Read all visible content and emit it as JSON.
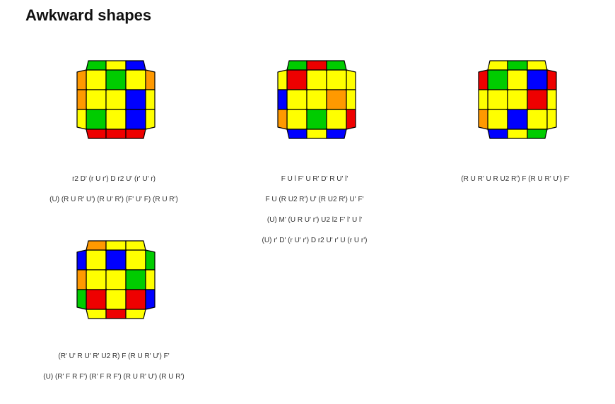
{
  "page": {
    "title": "Awkward shapes"
  },
  "colors": {
    "Y": "#ffff00",
    "R": "#ee0000",
    "G": "#00cc00",
    "B": "#0000ff",
    "O": "#ff9900",
    "border": "#000000"
  },
  "cases": [
    {
      "top": [
        "G",
        "Y",
        "B"
      ],
      "left": [
        "O",
        "O",
        "Y"
      ],
      "grid": [
        [
          "Y",
          "G",
          "Y"
        ],
        [
          "Y",
          "Y",
          "B"
        ],
        [
          "G",
          "Y",
          "B"
        ]
      ],
      "right": [
        "O",
        "Y",
        "Y"
      ],
      "bottom": [
        "R",
        "R",
        "R"
      ],
      "algs": [
        "r2 D' (r U r') D r2 U' (r' U' r)",
        "(U) (R U R' U') (R U' R') (F' U' F) (R U R')"
      ]
    },
    {
      "top": [
        "G",
        "R",
        "G"
      ],
      "left": [
        "Y",
        "B",
        "O"
      ],
      "grid": [
        [
          "R",
          "Y",
          "Y"
        ],
        [
          "Y",
          "Y",
          "O"
        ],
        [
          "Y",
          "G",
          "Y"
        ]
      ],
      "right": [
        "Y",
        "Y",
        "R"
      ],
      "bottom": [
        "B",
        "Y",
        "B"
      ],
      "algs": [
        "F U l F' U R' D' R U' l'",
        "F U (R U2 R') U' (R U2 R') U' F'",
        "(U) M' (U R U' r') U2 l2 F' l' U l'",
        "(U) r' D' (r U' r') D r2 U' r' U (r U r')"
      ]
    },
    {
      "top": [
        "Y",
        "G",
        "Y"
      ],
      "left": [
        "R",
        "Y",
        "O"
      ],
      "grid": [
        [
          "G",
          "Y",
          "B"
        ],
        [
          "Y",
          "Y",
          "R"
        ],
        [
          "Y",
          "B",
          "Y"
        ]
      ],
      "right": [
        "R",
        "Y",
        "Y"
      ],
      "bottom": [
        "B",
        "Y",
        "G"
      ],
      "algs": [
        "(R U R' U R U2 R') F (R U R' U') F'"
      ]
    },
    {
      "top": [
        "O",
        "Y",
        "Y"
      ],
      "left": [
        "B",
        "O",
        "G"
      ],
      "grid": [
        [
          "Y",
          "B",
          "Y"
        ],
        [
          "Y",
          "Y",
          "G"
        ],
        [
          "R",
          "Y",
          "R"
        ]
      ],
      "right": [
        "G",
        "Y",
        "B"
      ],
      "bottom": [
        "Y",
        "R",
        "Y"
      ],
      "algs": [
        "(R' U' R U' R' U2 R) F (R U R' U') F'",
        "(U) (R' F R F') (R' F R F') (R U R' U') (R U R')"
      ]
    }
  ]
}
